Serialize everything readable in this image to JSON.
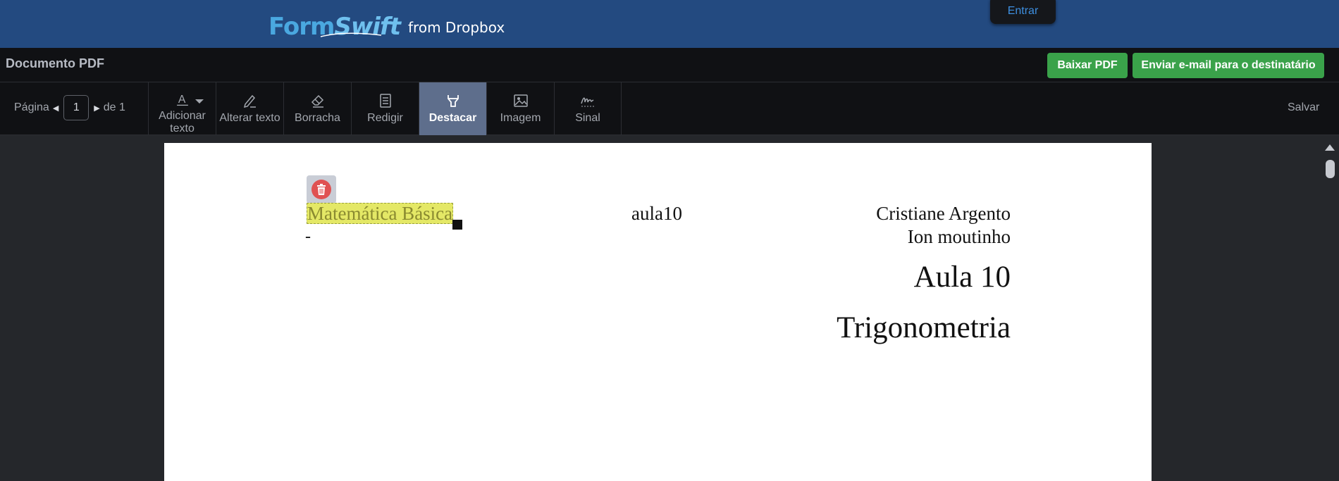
{
  "brand": {
    "logo_form": "Form",
    "logo_swift": "Swift",
    "logo_from": "from Dropbox",
    "login_label": "Entrar"
  },
  "docbar": {
    "title": "Documento PDF",
    "download_label": "Baixar PDF",
    "email_label": "Enviar e-mail para o destinatário"
  },
  "toolbar": {
    "page_label": "Página",
    "page_value": "1",
    "page_total": "de 1",
    "tools": [
      {
        "label": "Adicionar texto",
        "icon": "text-icon"
      },
      {
        "label": "Alterar texto",
        "icon": "pencil-icon"
      },
      {
        "label": "Borracha",
        "icon": "eraser-icon"
      },
      {
        "label": "Redigir",
        "icon": "redact-icon"
      },
      {
        "label": "Destacar",
        "icon": "highlighter-icon",
        "active": true
      },
      {
        "label": "Imagem",
        "icon": "image-icon"
      },
      {
        "label": "Sinal",
        "icon": "signature-icon"
      }
    ],
    "save_label": "Salvar"
  },
  "pdf": {
    "course": "Matemática Básica",
    "dash": "-",
    "lesson_code": "aula10",
    "author_1": "Cristiane Argento",
    "author_2": "Ion moutinho",
    "heading": "Aula 10",
    "subject": "Trigonometria"
  },
  "colors": {
    "brand_bar": "#234a80",
    "accent_green": "#3aa24a",
    "active_tool": "#5e6e8c",
    "highlight": "#e4e866",
    "delete_red": "#e05252"
  }
}
